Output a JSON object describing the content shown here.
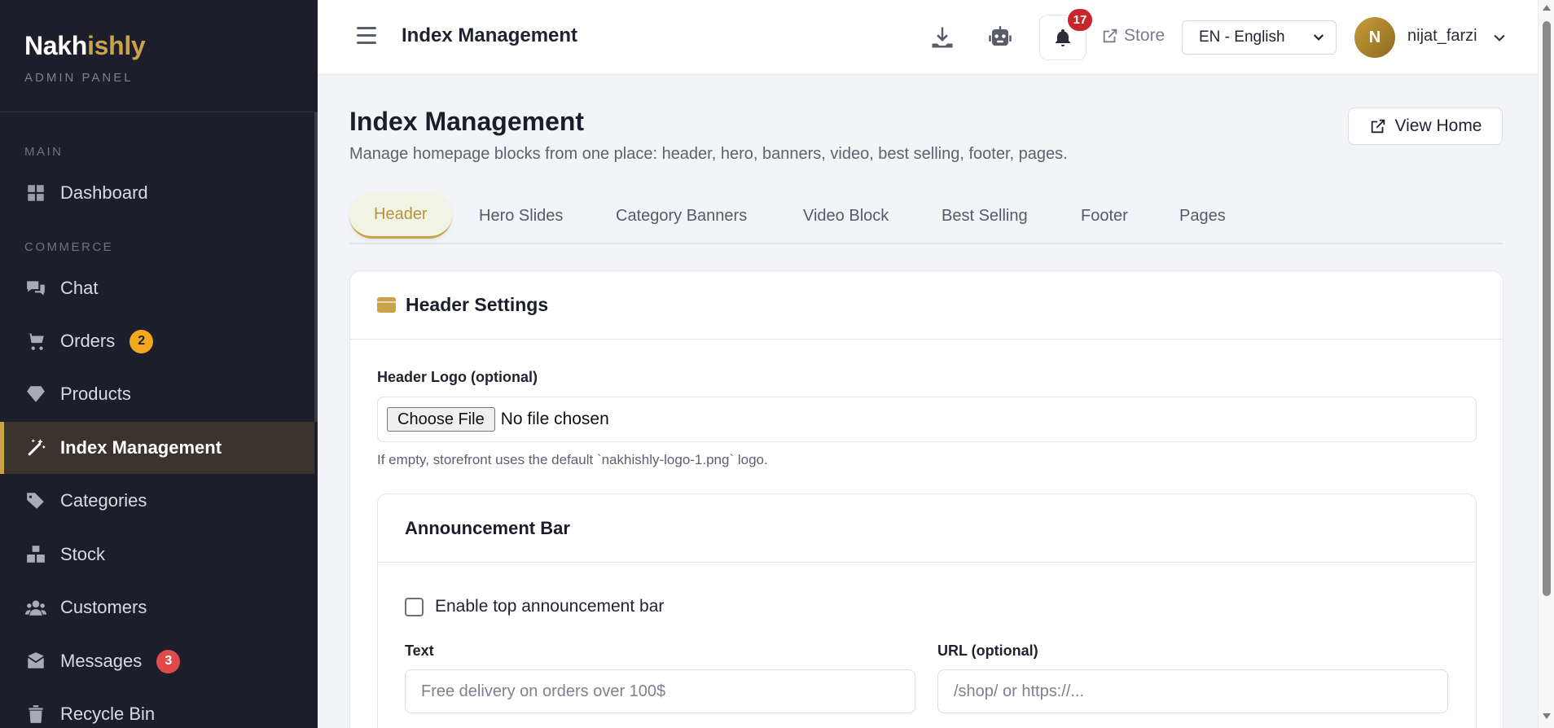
{
  "brand": {
    "name_part1": "Nakh",
    "name_part2": "ishly",
    "subtitle": "ADMIN PANEL"
  },
  "sidebar": {
    "sections": {
      "main": "MAIN",
      "commerce": "COMMERCE"
    },
    "items": [
      {
        "label": "Dashboard",
        "icon": "dashboard-icon"
      },
      {
        "label": "Chat",
        "icon": "chat-icon"
      },
      {
        "label": "Orders",
        "icon": "cart-icon",
        "badge": "2"
      },
      {
        "label": "Products",
        "icon": "gem-icon"
      },
      {
        "label": "Index Management",
        "icon": "magic-wand-icon",
        "active": true
      },
      {
        "label": "Categories",
        "icon": "tags-icon"
      },
      {
        "label": "Stock",
        "icon": "boxes-icon"
      },
      {
        "label": "Customers",
        "icon": "users-icon"
      },
      {
        "label": "Messages",
        "icon": "mail-icon",
        "badge": "3"
      },
      {
        "label": "Recycle Bin",
        "icon": "trash-icon"
      }
    ]
  },
  "topbar": {
    "title": "Index Management",
    "notifications_count": "17",
    "store_label": "Store",
    "language": "EN - English",
    "avatar_initial": "N",
    "username": "nijat_farzi"
  },
  "page": {
    "title": "Index Management",
    "subtitle": "Manage homepage blocks from one place: header, hero, banners, video, best selling, footer, pages.",
    "view_home_label": "View Home"
  },
  "tabs": [
    {
      "label": "Header",
      "active": true
    },
    {
      "label": "Hero Slides"
    },
    {
      "label": "Category Banners"
    },
    {
      "label": "Video Block"
    },
    {
      "label": "Best Selling"
    },
    {
      "label": "Footer"
    },
    {
      "label": "Pages"
    }
  ],
  "header_settings": {
    "title": "Header Settings",
    "logo_label": "Header Logo (optional)",
    "choose_file_label": "Choose File",
    "file_status": "No file chosen",
    "help_text": "If empty, storefront uses the default `nakhishly-logo-1.png` logo."
  },
  "announcement": {
    "title": "Announcement Bar",
    "enable_label": "Enable top announcement bar",
    "enabled": false,
    "text_label": "Text",
    "text_placeholder": "Free delivery on orders over 100$",
    "url_label": "URL (optional)",
    "url_placeholder": "/shop/ or https://..."
  },
  "colors": {
    "accent": "#c9a24a",
    "sidebar_bg": "#1d1e2c",
    "badge_orange": "#f1a81d",
    "badge_red": "#e04a4a"
  }
}
